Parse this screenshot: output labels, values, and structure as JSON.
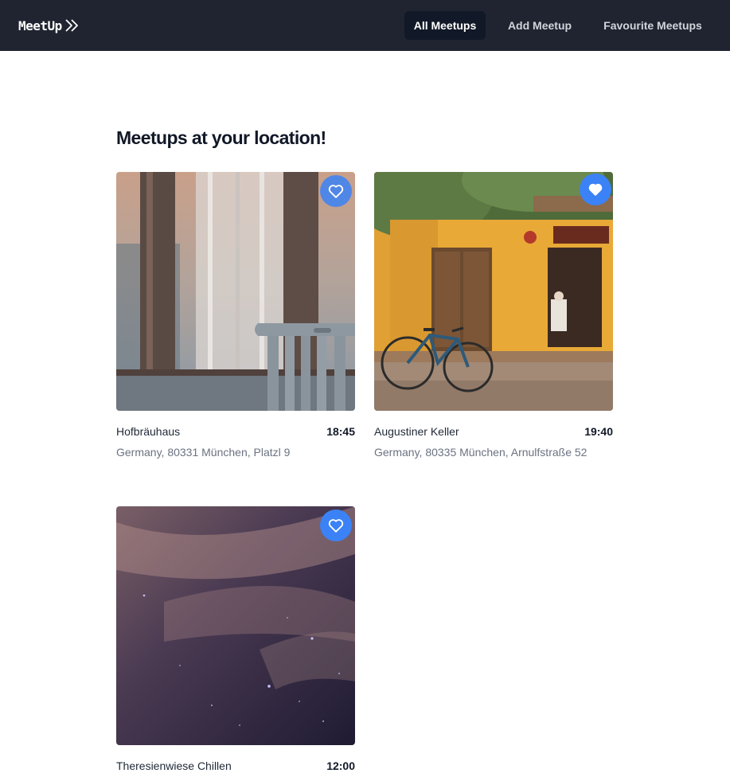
{
  "app": {
    "logo_text": "MeetUp"
  },
  "nav": {
    "items": [
      {
        "label": "All Meetups",
        "active": true
      },
      {
        "label": "Add Meetup",
        "active": false
      },
      {
        "label": "Favourite Meetups",
        "active": false
      }
    ]
  },
  "main": {
    "title": "Meetups at your location!",
    "meetups": [
      {
        "name": "Hofbräuhaus",
        "time": "18:45",
        "address": "Germany, 80331 München, Platzl 9",
        "favourite": false,
        "image": "window-curtain-chair-photo"
      },
      {
        "name": "Augustiner Keller",
        "time": "19:40",
        "address": "Germany, 80335 München, Arnulfstraße 52",
        "favourite": true,
        "image": "yellow-house-bicycle-photo"
      },
      {
        "name": "Theresienwiese Chillen",
        "time": "12:00",
        "address": "",
        "favourite": false,
        "image": "night-sky-stars-photo"
      }
    ]
  },
  "colors": {
    "navbar": "#1f2430",
    "accent": "#3b82f6",
    "text": "#111827",
    "muted": "#6b7280"
  }
}
